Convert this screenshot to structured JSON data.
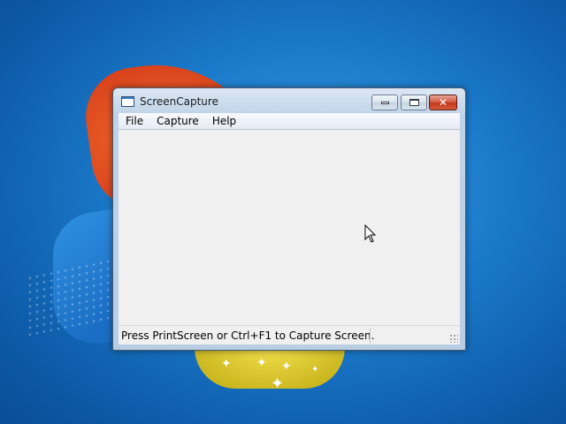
{
  "window": {
    "title": "ScreenCapture",
    "icon": "app-window-icon",
    "controls": {
      "minimize": "minimize-icon",
      "maximize": "maximize-icon",
      "close": "✕"
    }
  },
  "menubar": {
    "items": [
      {
        "label": "File"
      },
      {
        "label": "Capture"
      },
      {
        "label": "Help"
      }
    ]
  },
  "statusbar": {
    "message": "Press PrintScreen or Ctrl+F1 to Capture Screen."
  },
  "colors": {
    "desktop_blue": "#1a78c8",
    "close_red": "#c2361b",
    "client_bg": "#f0f0f0"
  }
}
